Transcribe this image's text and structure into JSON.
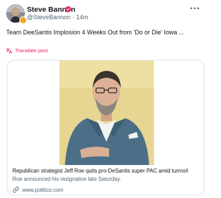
{
  "post": {
    "author_name": "Steve Bannon",
    "author_handle": "@SteveBannon",
    "separator": "·",
    "time": "14m",
    "text": "Team DeeSantis Implosion 4 Weeks Out from 'Do or Die' Iowa ...",
    "translate_label": "Translate post",
    "icons": {
      "verified": "verified-badge-icon",
      "more": "more-options-icon",
      "translate": "translate-icon",
      "link": "link-icon"
    },
    "colors": {
      "verified": "#e0245e",
      "translate": "#e0245e",
      "secondary_text": "#536471"
    }
  },
  "card": {
    "title": "Republican strategist Jeff Roe quits pro-DeSantis super PAC amid turmoil",
    "description": "Roe announced his resignation late Saturday.",
    "domain": "www.politico.com"
  }
}
